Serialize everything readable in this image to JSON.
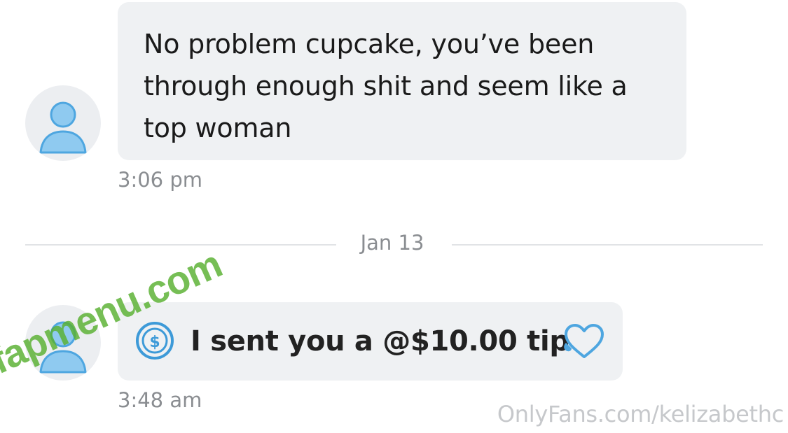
{
  "messages": [
    {
      "text": "No problem cupcake, you’ve been through enough shit and seem like a top woman",
      "time": "3:06 pm"
    },
    {
      "text": "I sent you a @$10.00 tip",
      "time": "3:48 am",
      "icon": "dollar-coin-icon",
      "emoji": "heart-icon"
    }
  ],
  "divider": {
    "date": "Jan 13"
  },
  "watermark": {
    "text": "fapmenu.com"
  },
  "footer": {
    "site": "OnlyFans.com/kelizabethc"
  },
  "colors": {
    "bubble": "#eff1f3",
    "avatar_bg": "#eceef1",
    "avatar_figure": "#5aaee6",
    "timestamp": "#8a8d91",
    "watermark": "#58b030"
  }
}
